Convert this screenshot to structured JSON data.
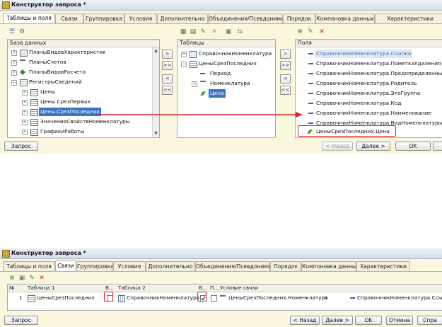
{
  "window1": {
    "title": "Конструктор запроса *",
    "tabs": [
      "Таблицы и поля",
      "Связи",
      "Группировка",
      "Условия",
      "Дополнительно",
      "Объединения/Псевдонимы",
      "Порядок",
      "Компоновка данных",
      "Характеристики"
    ],
    "active_tab": 0,
    "db_panel": {
      "header": "База данных",
      "items": [
        "ПланыВидовХарактеристик",
        "ПланыСчетов",
        "ПланыВидовРасчета",
        "РегистрыСведений",
        "Цены",
        "Цены.СрезПервых",
        "Цены.СрезПоследних",
        "ЗначенияСвойствНоменклатуры",
        "ГрафикиРаботы"
      ]
    },
    "tables_panel": {
      "header": "Таблицы",
      "items": [
        "СправочникНоменклатура",
        "ЦеныСрезПоследних",
        "Период",
        "Номенклатура",
        "Цена"
      ]
    },
    "fields_panel": {
      "header": "Поля",
      "items": [
        "СправочникНоменклатура.Ссылка",
        "СправочникНоменклатура.ПометкаУдаления",
        "СправочникНоменклатура.Предопределенный",
        "СправочникНоменклатура.Родитель",
        "СправочникНоменклатура.ЭтоГруппа",
        "СправочникНоменклатура.Код",
        "СправочникНоменклатура.Наименование",
        "СправочникНоменклатура.ВидНоменклатуры",
        "ЦеныСрезПоследних.Цена"
      ]
    },
    "move_buttons": [
      ">",
      ">>",
      "<",
      "<<"
    ],
    "footer": {
      "query": "Запрос",
      "back": "< Назад",
      "next": "Далее >",
      "ok": "OK"
    }
  },
  "window2": {
    "title": "Конструктор запроса *",
    "tabs": [
      "Таблицы и поля",
      "Связи",
      "Группировка",
      "Условия",
      "Дополнительно",
      "Объединения/Псевдонимы",
      "Порядок",
      "Компоновка данных",
      "Характеристики"
    ],
    "active_tab": 1,
    "grid": {
      "headers": [
        "№",
        "Таблица 1",
        "В...",
        "Таблица 2",
        "В...",
        "П...",
        "Условие связи"
      ],
      "row": {
        "num": "1",
        "table1": "ЦеныСрезПоследних",
        "all1": false,
        "table2": "СправочникНоменклатура",
        "all2": true,
        "p": false,
        "cond_left": "ЦеныСрезПоследних.Номенклатура",
        "cond_op": "=",
        "cond_right": "СправочникНоменклатура.Ссылка"
      }
    },
    "footer": {
      "query": "Запрос",
      "back": "< Назад",
      "next": "Далее >",
      "ok": "OK",
      "cancel": "Отмена",
      "help": "Спра"
    }
  },
  "colors": {
    "accent_red": "#e02020",
    "selection": "#3b73c6",
    "window_bg": "#fbf6de"
  }
}
